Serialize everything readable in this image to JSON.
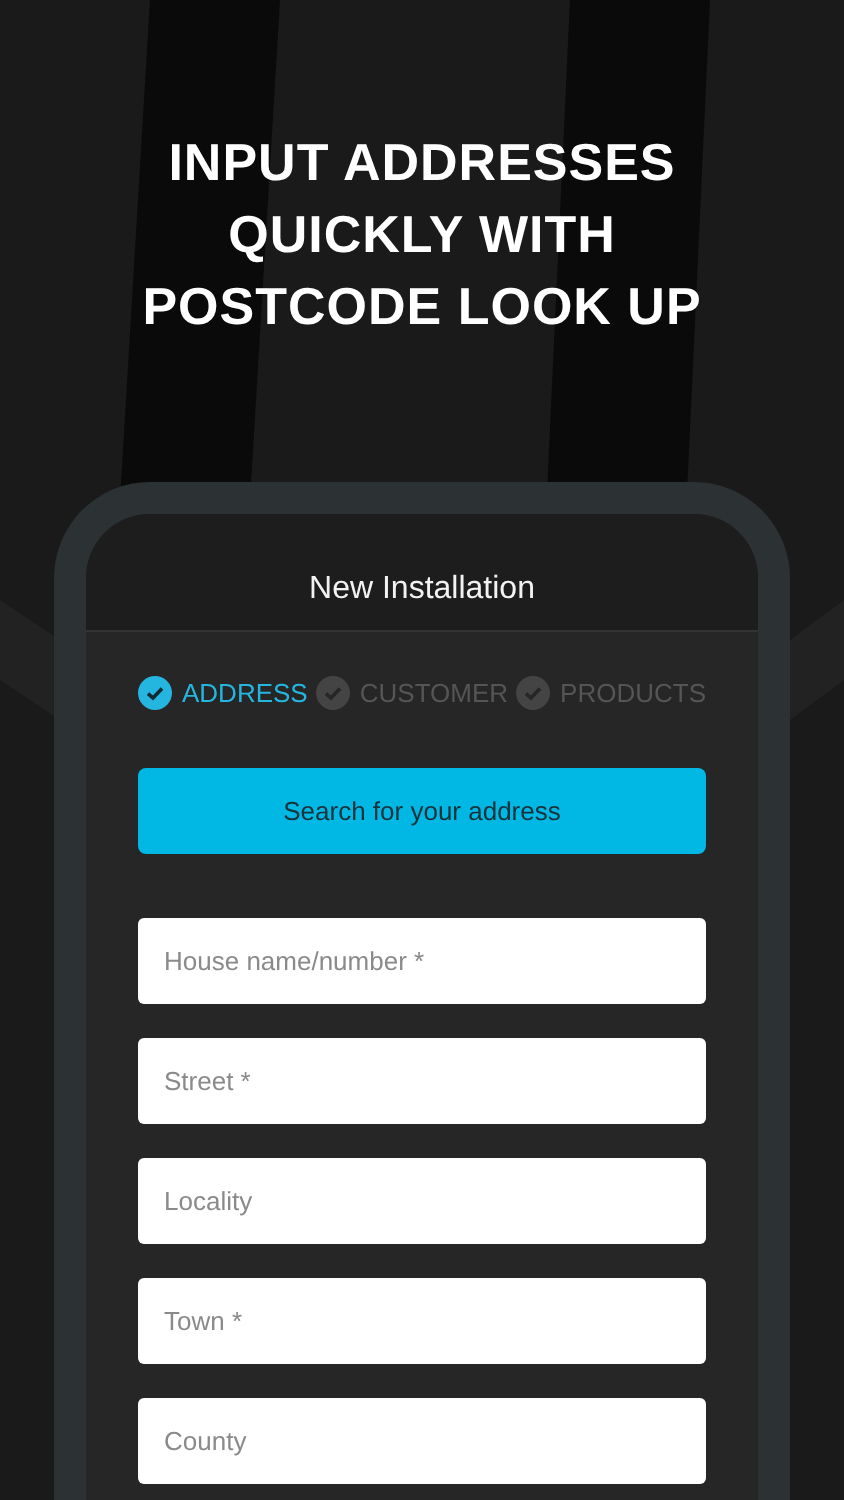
{
  "headline": [
    "INPUT ADDRESSES",
    "QUICKLY WITH",
    "POSTCODE LOOK UP"
  ],
  "screen": {
    "title": "New Installation",
    "steps": [
      {
        "label": "ADDRESS",
        "selected": true
      },
      {
        "label": "CUSTOMER",
        "selected": false
      },
      {
        "label": "PRODUCTS",
        "selected": false
      }
    ],
    "search_button": "Search for your address",
    "fields": [
      {
        "placeholder": "House name/number *"
      },
      {
        "placeholder": "Street *"
      },
      {
        "placeholder": "Locality"
      },
      {
        "placeholder": "Town *"
      },
      {
        "placeholder": "County"
      }
    ]
  }
}
